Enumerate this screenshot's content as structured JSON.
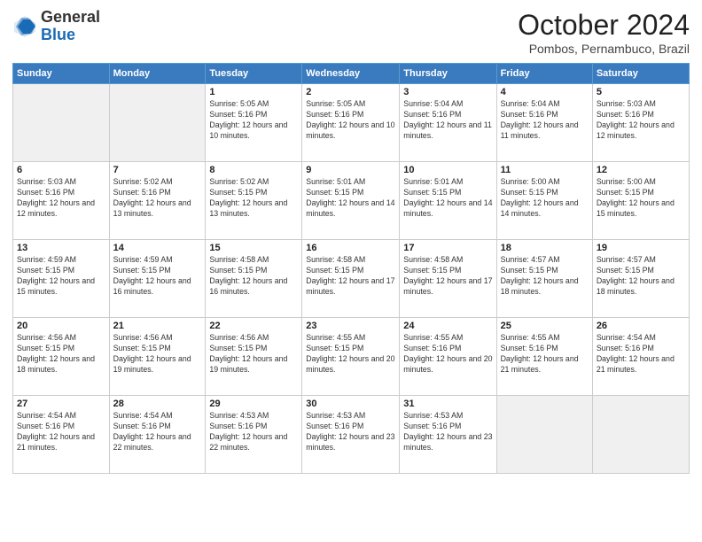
{
  "logo": {
    "general": "General",
    "blue": "Blue"
  },
  "title": "October 2024",
  "location": "Pombos, Pernambuco, Brazil",
  "days_header": [
    "Sunday",
    "Monday",
    "Tuesday",
    "Wednesday",
    "Thursday",
    "Friday",
    "Saturday"
  ],
  "weeks": [
    [
      {
        "day": "",
        "info": ""
      },
      {
        "day": "",
        "info": ""
      },
      {
        "day": "1",
        "info": "Sunrise: 5:05 AM\nSunset: 5:16 PM\nDaylight: 12 hours and 10 minutes."
      },
      {
        "day": "2",
        "info": "Sunrise: 5:05 AM\nSunset: 5:16 PM\nDaylight: 12 hours and 10 minutes."
      },
      {
        "day": "3",
        "info": "Sunrise: 5:04 AM\nSunset: 5:16 PM\nDaylight: 12 hours and 11 minutes."
      },
      {
        "day": "4",
        "info": "Sunrise: 5:04 AM\nSunset: 5:16 PM\nDaylight: 12 hours and 11 minutes."
      },
      {
        "day": "5",
        "info": "Sunrise: 5:03 AM\nSunset: 5:16 PM\nDaylight: 12 hours and 12 minutes."
      }
    ],
    [
      {
        "day": "6",
        "info": "Sunrise: 5:03 AM\nSunset: 5:16 PM\nDaylight: 12 hours and 12 minutes."
      },
      {
        "day": "7",
        "info": "Sunrise: 5:02 AM\nSunset: 5:16 PM\nDaylight: 12 hours and 13 minutes."
      },
      {
        "day": "8",
        "info": "Sunrise: 5:02 AM\nSunset: 5:15 PM\nDaylight: 12 hours and 13 minutes."
      },
      {
        "day": "9",
        "info": "Sunrise: 5:01 AM\nSunset: 5:15 PM\nDaylight: 12 hours and 14 minutes."
      },
      {
        "day": "10",
        "info": "Sunrise: 5:01 AM\nSunset: 5:15 PM\nDaylight: 12 hours and 14 minutes."
      },
      {
        "day": "11",
        "info": "Sunrise: 5:00 AM\nSunset: 5:15 PM\nDaylight: 12 hours and 14 minutes."
      },
      {
        "day": "12",
        "info": "Sunrise: 5:00 AM\nSunset: 5:15 PM\nDaylight: 12 hours and 15 minutes."
      }
    ],
    [
      {
        "day": "13",
        "info": "Sunrise: 4:59 AM\nSunset: 5:15 PM\nDaylight: 12 hours and 15 minutes."
      },
      {
        "day": "14",
        "info": "Sunrise: 4:59 AM\nSunset: 5:15 PM\nDaylight: 12 hours and 16 minutes."
      },
      {
        "day": "15",
        "info": "Sunrise: 4:58 AM\nSunset: 5:15 PM\nDaylight: 12 hours and 16 minutes."
      },
      {
        "day": "16",
        "info": "Sunrise: 4:58 AM\nSunset: 5:15 PM\nDaylight: 12 hours and 17 minutes."
      },
      {
        "day": "17",
        "info": "Sunrise: 4:58 AM\nSunset: 5:15 PM\nDaylight: 12 hours and 17 minutes."
      },
      {
        "day": "18",
        "info": "Sunrise: 4:57 AM\nSunset: 5:15 PM\nDaylight: 12 hours and 18 minutes."
      },
      {
        "day": "19",
        "info": "Sunrise: 4:57 AM\nSunset: 5:15 PM\nDaylight: 12 hours and 18 minutes."
      }
    ],
    [
      {
        "day": "20",
        "info": "Sunrise: 4:56 AM\nSunset: 5:15 PM\nDaylight: 12 hours and 18 minutes."
      },
      {
        "day": "21",
        "info": "Sunrise: 4:56 AM\nSunset: 5:15 PM\nDaylight: 12 hours and 19 minutes."
      },
      {
        "day": "22",
        "info": "Sunrise: 4:56 AM\nSunset: 5:15 PM\nDaylight: 12 hours and 19 minutes."
      },
      {
        "day": "23",
        "info": "Sunrise: 4:55 AM\nSunset: 5:15 PM\nDaylight: 12 hours and 20 minutes."
      },
      {
        "day": "24",
        "info": "Sunrise: 4:55 AM\nSunset: 5:16 PM\nDaylight: 12 hours and 20 minutes."
      },
      {
        "day": "25",
        "info": "Sunrise: 4:55 AM\nSunset: 5:16 PM\nDaylight: 12 hours and 21 minutes."
      },
      {
        "day": "26",
        "info": "Sunrise: 4:54 AM\nSunset: 5:16 PM\nDaylight: 12 hours and 21 minutes."
      }
    ],
    [
      {
        "day": "27",
        "info": "Sunrise: 4:54 AM\nSunset: 5:16 PM\nDaylight: 12 hours and 21 minutes."
      },
      {
        "day": "28",
        "info": "Sunrise: 4:54 AM\nSunset: 5:16 PM\nDaylight: 12 hours and 22 minutes."
      },
      {
        "day": "29",
        "info": "Sunrise: 4:53 AM\nSunset: 5:16 PM\nDaylight: 12 hours and 22 minutes."
      },
      {
        "day": "30",
        "info": "Sunrise: 4:53 AM\nSunset: 5:16 PM\nDaylight: 12 hours and 23 minutes."
      },
      {
        "day": "31",
        "info": "Sunrise: 4:53 AM\nSunset: 5:16 PM\nDaylight: 12 hours and 23 minutes."
      },
      {
        "day": "",
        "info": ""
      },
      {
        "day": "",
        "info": ""
      }
    ]
  ]
}
